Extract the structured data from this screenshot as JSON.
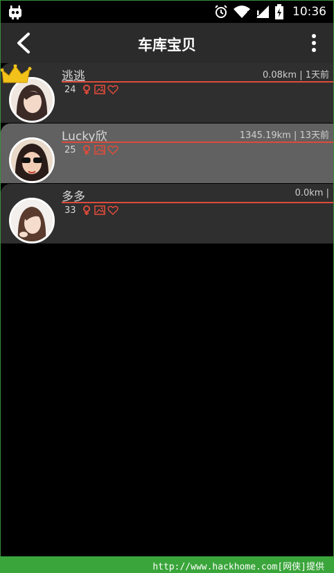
{
  "status_bar": {
    "time": "10:36"
  },
  "app_bar": {
    "title": "车库宝贝"
  },
  "users": [
    {
      "name": "逃逃",
      "age": "24",
      "meta": "0.08km | 1天前",
      "crown": true,
      "selected": false
    },
    {
      "name": "Lucky欣",
      "age": "25",
      "meta": "1345.19km | 13天前",
      "crown": false,
      "selected": true
    },
    {
      "name": "多多",
      "age": "33",
      "meta": "0.0km |",
      "crown": false,
      "selected": false
    }
  ],
  "footer": {
    "text": "http://www.hackhome.com[网侠]提供"
  },
  "colors": {
    "accent": "#e04b3a",
    "row_bg": "#2f2f2f",
    "row_selected_bg": "#616161",
    "appbar_bg": "#2b2b2b",
    "footer_bg": "#3aa53a"
  }
}
